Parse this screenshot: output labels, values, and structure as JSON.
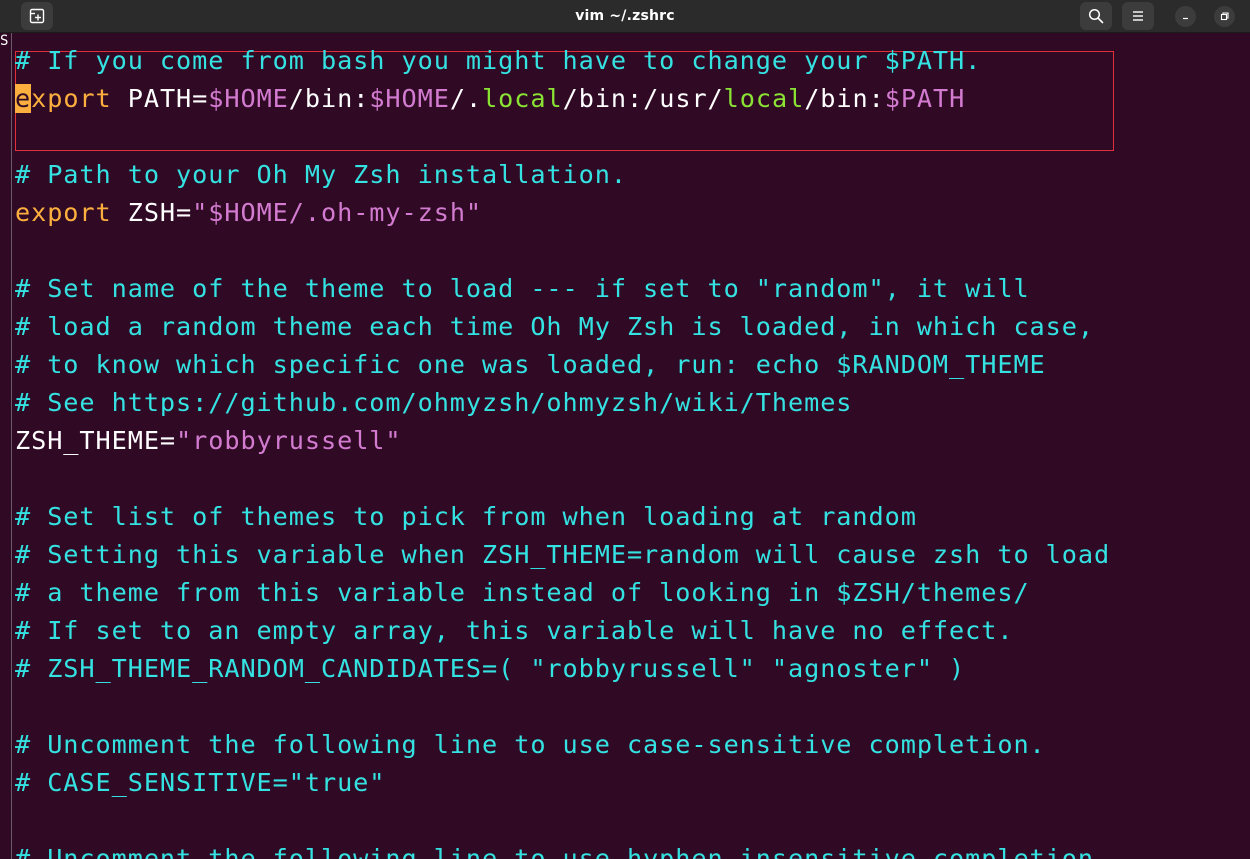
{
  "window": {
    "title": "vim ~/.zshrc"
  },
  "titlebar": {
    "new_tab_icon": "new-tab-icon",
    "search_icon": "search-icon",
    "menu_icon": "hamburger-menu-icon",
    "minimize_icon": "minimize-icon",
    "restore_icon": "restore-icon"
  },
  "editor": {
    "edge_glyph": "S",
    "lines": [
      {
        "id": "l1",
        "segments": [
          {
            "cls": "cm",
            "text": "# If you come from bash you might have to change your $PATH."
          }
        ]
      },
      {
        "id": "l2",
        "segments": [
          {
            "cls": "cursor",
            "text": "e"
          },
          {
            "cls": "kw",
            "text": "xport"
          },
          {
            "cls": "",
            "text": " PATH="
          },
          {
            "cls": "str",
            "text": "$HOME"
          },
          {
            "cls": "",
            "text": "/bin:"
          },
          {
            "cls": "str",
            "text": "$HOME"
          },
          {
            "cls": "",
            "text": "/."
          },
          {
            "cls": "gr",
            "text": "local"
          },
          {
            "cls": "",
            "text": "/bin:/usr/"
          },
          {
            "cls": "gr",
            "text": "local"
          },
          {
            "cls": "",
            "text": "/bin:"
          },
          {
            "cls": "str",
            "text": "$PATH"
          }
        ]
      },
      {
        "id": "l3",
        "segments": []
      },
      {
        "id": "l4",
        "segments": [
          {
            "cls": "cm",
            "text": "# Path to your Oh My Zsh installation."
          }
        ]
      },
      {
        "id": "l5",
        "segments": [
          {
            "cls": "kw",
            "text": "export"
          },
          {
            "cls": "",
            "text": " ZSH="
          },
          {
            "cls": "str",
            "text": "\"$HOME"
          },
          {
            "cls": "str",
            "text": "/.oh-my-zsh\""
          }
        ]
      },
      {
        "id": "l6",
        "segments": []
      },
      {
        "id": "l7",
        "segments": [
          {
            "cls": "cm",
            "text": "# Set name of the theme to load --- if set to \"random\", it will"
          }
        ]
      },
      {
        "id": "l8",
        "segments": [
          {
            "cls": "cm",
            "text": "# load a random theme each time Oh My Zsh is loaded, in which case,"
          }
        ]
      },
      {
        "id": "l9",
        "segments": [
          {
            "cls": "cm",
            "text": "# to know which specific one was loaded, run: echo $RANDOM_THEME"
          }
        ]
      },
      {
        "id": "l10",
        "segments": [
          {
            "cls": "cm",
            "text": "# See https://github.com/ohmyzsh/ohmyzsh/wiki/Themes"
          }
        ]
      },
      {
        "id": "l11",
        "segments": [
          {
            "cls": "",
            "text": "ZSH_THEME="
          },
          {
            "cls": "str",
            "text": "\"robbyrussell\""
          }
        ]
      },
      {
        "id": "l12",
        "segments": []
      },
      {
        "id": "l13",
        "segments": [
          {
            "cls": "cm",
            "text": "# Set list of themes to pick from when loading at random"
          }
        ]
      },
      {
        "id": "l14",
        "segments": [
          {
            "cls": "cm",
            "text": "# Setting this variable when ZSH_THEME=random will cause zsh to load"
          }
        ]
      },
      {
        "id": "l15",
        "segments": [
          {
            "cls": "cm",
            "text": "# a theme from this variable instead of looking in $ZSH/themes/"
          }
        ]
      },
      {
        "id": "l16",
        "segments": [
          {
            "cls": "cm",
            "text": "# If set to an empty array, this variable will have no effect."
          }
        ]
      },
      {
        "id": "l17",
        "segments": [
          {
            "cls": "cm",
            "text": "# ZSH_THEME_RANDOM_CANDIDATES=( \"robbyrussell\" \"agnoster\" )"
          }
        ]
      },
      {
        "id": "l18",
        "segments": []
      },
      {
        "id": "l19",
        "segments": [
          {
            "cls": "cm",
            "text": "# Uncomment the following line to use case-sensitive completion."
          }
        ]
      },
      {
        "id": "l20",
        "segments": [
          {
            "cls": "cm",
            "text": "# CASE_SENSITIVE=\"true\""
          }
        ]
      },
      {
        "id": "l21",
        "segments": []
      },
      {
        "id": "l22",
        "segments": [
          {
            "cls": "cm",
            "text": "# Uncomment the following line to use hyphen-insensitive completion."
          }
        ]
      }
    ]
  },
  "colors": {
    "background": "#300a24",
    "comment": "#34e2e2",
    "keyword": "#fcaf3e",
    "string": "#d27bd0",
    "path_word": "#8ae234",
    "highlight_border": "#e0303a"
  }
}
